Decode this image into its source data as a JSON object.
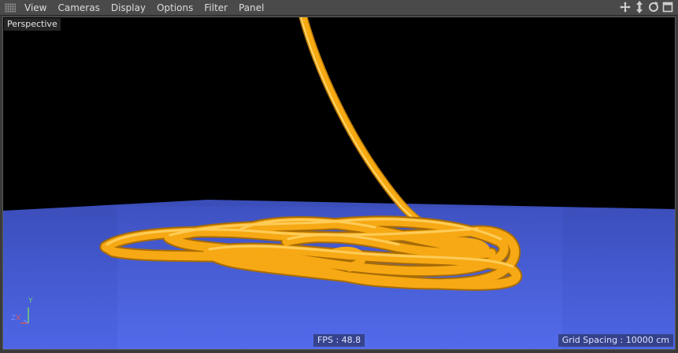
{
  "menubar": {
    "items": [
      "View",
      "Cameras",
      "Display",
      "Options",
      "Filter",
      "Panel"
    ],
    "nav_icons": [
      "move-icon",
      "zoom-icon",
      "rotate-icon",
      "maximize-icon"
    ]
  },
  "viewport": {
    "camera_label": "Perspective",
    "fps_text": "FPS : 48.8",
    "grid_spacing_text": "Grid Spacing : 10000 cm",
    "axis_labels": {
      "y": "Y",
      "z": "Z",
      "x": "X"
    },
    "colors": {
      "background": "#000000",
      "floor": "#4b60dc",
      "rope": "#f5a814"
    }
  }
}
